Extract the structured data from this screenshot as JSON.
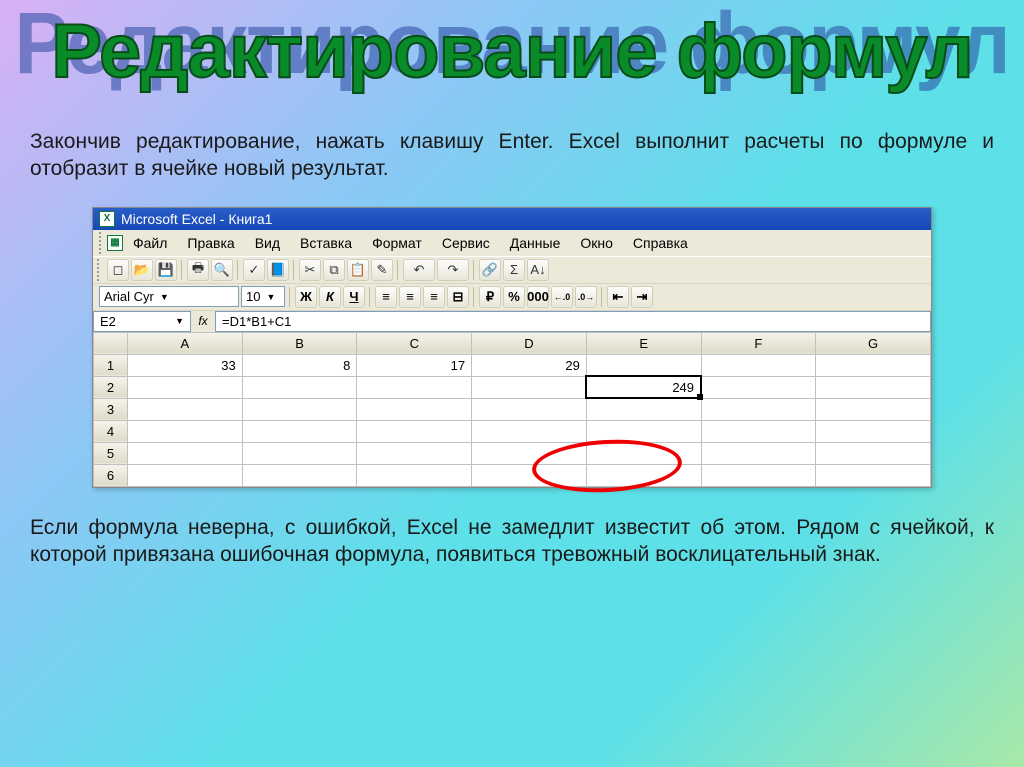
{
  "slide": {
    "title": "Редактирование формул",
    "intro_text": "Закончив редактирование, нажать клавишу Enter. Excel выполнит расчеты по формуле и отобразит в ячейке новый результат.",
    "outro_text": "Если формула неверна, с ошибкой, Excel не замедлит  известит об этом. Рядом с ячейкой, к которой привязана ошибочная формула, появиться тревожный восклицательный знак."
  },
  "excel": {
    "titlebar": "Microsoft Excel - Книга1",
    "menu": [
      "Файл",
      "Правка",
      "Вид",
      "Вставка",
      "Формат",
      "Сервис",
      "Данные",
      "Окно",
      "Справка"
    ],
    "font_name": "Arial Cyr",
    "font_size": "10",
    "name_box": "E2",
    "fx_label": "fx",
    "formula": "=D1*B1+C1",
    "columns": [
      "A",
      "B",
      "C",
      "D",
      "E",
      "F",
      "G"
    ],
    "rows": [
      {
        "n": "1",
        "cells": [
          "33",
          "8",
          "17",
          "29",
          "",
          "",
          ""
        ]
      },
      {
        "n": "2",
        "cells": [
          "",
          "",
          "",
          "",
          "249",
          "",
          ""
        ]
      },
      {
        "n": "3",
        "cells": [
          "",
          "",
          "",
          "",
          "",
          "",
          ""
        ]
      },
      {
        "n": "4",
        "cells": [
          "",
          "",
          "",
          "",
          "",
          "",
          ""
        ]
      },
      {
        "n": "5",
        "cells": [
          "",
          "",
          "",
          "",
          "",
          "",
          ""
        ]
      },
      {
        "n": "6",
        "cells": [
          "",
          "",
          "",
          "",
          "",
          "",
          ""
        ]
      }
    ],
    "selected": {
      "row": 1,
      "col": 4
    }
  },
  "icons": {
    "new": "◻",
    "open": "📂",
    "save": "💾",
    "print": "🖶",
    "preview": "🔍",
    "spell": "✓",
    "cut": "✂",
    "copy": "⧉",
    "paste": "📋",
    "fmtpaint": "✎",
    "undo": "↶",
    "redo": "↷",
    "link": "🔗",
    "sum": "Σ",
    "sort": "A↓",
    "bold": "Ж",
    "italic": "К",
    "under": "Ч",
    "al": "≡",
    "ac": "≡",
    "ar": "≡",
    "merge": "⊟",
    "curr": "₽",
    "pct": "%",
    "comma": "000",
    "dec0": "←.0",
    "dec1": ".0→",
    "indent0": "⇤",
    "indent1": "⇥"
  }
}
